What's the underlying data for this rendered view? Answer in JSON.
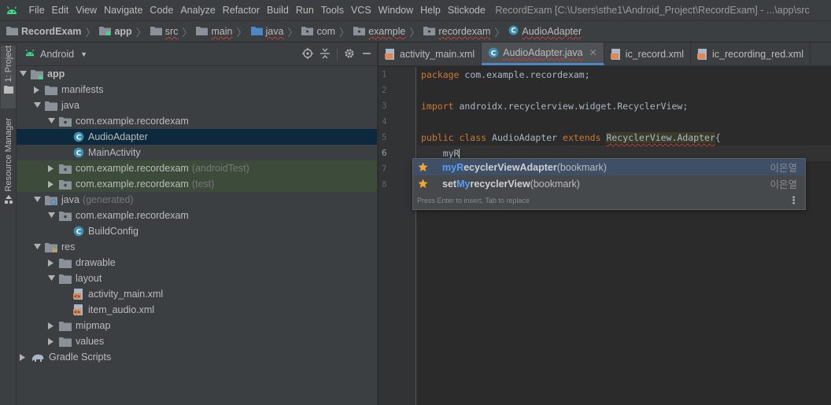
{
  "menubar": {
    "items": [
      "File",
      "Edit",
      "View",
      "Navigate",
      "Code",
      "Analyze",
      "Refactor",
      "Build",
      "Run",
      "Tools",
      "VCS",
      "Window",
      "Help",
      "Stickode"
    ],
    "window_title": "RecordExam [C:\\Users\\sthe1\\Android_Project\\RecordExam] - ...\\app\\src"
  },
  "breadcrumb": [
    "RecordExam",
    "app",
    "src",
    "main",
    "java",
    "com",
    "example",
    "recordexam",
    "AudioAdapter"
  ],
  "toolstrip": {
    "project_tab": "1: Project",
    "resource_tab": "Resource Manager"
  },
  "project": {
    "view_mode": "Android",
    "tree": [
      {
        "label": "app",
        "hint": ""
      },
      {
        "label": "manifests",
        "hint": ""
      },
      {
        "label": "java",
        "hint": ""
      },
      {
        "label": "com.example.recordexam",
        "hint": ""
      },
      {
        "label": "AudioAdapter",
        "hint": ""
      },
      {
        "label": "MainActivity",
        "hint": ""
      },
      {
        "label": "com.example.recordexam",
        "hint": "(androidTest)"
      },
      {
        "label": "com.example.recordexam",
        "hint": "(test)"
      },
      {
        "label": "java",
        "hint": "(generated)"
      },
      {
        "label": "com.example.recordexam",
        "hint": ""
      },
      {
        "label": "BuildConfig",
        "hint": ""
      },
      {
        "label": "res",
        "hint": ""
      },
      {
        "label": "drawable",
        "hint": ""
      },
      {
        "label": "layout",
        "hint": ""
      },
      {
        "label": "activity_main.xml",
        "hint": ""
      },
      {
        "label": "item_audio.xml",
        "hint": ""
      },
      {
        "label": "mipmap",
        "hint": ""
      },
      {
        "label": "values",
        "hint": ""
      },
      {
        "label": "Gradle Scripts",
        "hint": ""
      }
    ]
  },
  "editor": {
    "tabs": [
      {
        "label": "activity_main.xml"
      },
      {
        "label": "AudioAdapter.java"
      },
      {
        "label": "ic_record.xml"
      },
      {
        "label": "ic_recording_red.xml"
      }
    ],
    "line_numbers": [
      "1",
      "2",
      "3",
      "4",
      "5",
      "6",
      "7",
      "8"
    ],
    "code": {
      "l1_kw": "package",
      "l1_rest": " com.example.recordexam;",
      "l3_kw": "import",
      "l3_rest": " androidx.recyclerview.widget.RecyclerView;",
      "l5_kw1": "public class",
      "l5_name": " AudioAdapter ",
      "l5_kw2": "extends",
      "l5_space": " ",
      "l5_super": "RecyclerView.Adapter",
      "l5_brace": "{",
      "l6_text": "    myR"
    }
  },
  "autocomplete": {
    "items": [
      {
        "match": "myR",
        "rest": "ecyclerViewAdapter",
        "suffix": "(bookmark)",
        "author": "이은열"
      },
      {
        "pre": "set",
        "match": "My",
        "mid": "r",
        "rest": "ecyclerView",
        "suffix": "(bookmark)",
        "author": "이은열"
      }
    ],
    "footer": "Press Enter to insert, Tab to replace"
  },
  "colors": {
    "accent": "#4a88c7",
    "keyword": "#cc7832",
    "match": "#589df6",
    "star": "#f0a732"
  }
}
